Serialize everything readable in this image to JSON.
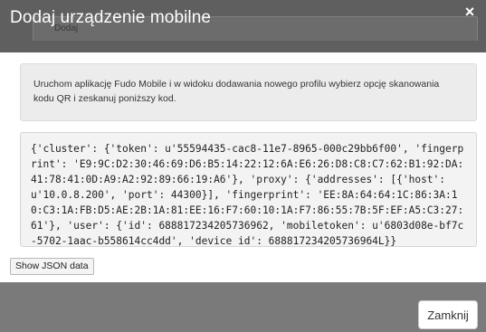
{
  "dialog": {
    "title": "Dodaj urządzenie mobilne",
    "background_tab_label": "Dodaj",
    "info_text": "Uruchom aplikację Fudo Mobile i w widoku dodawania nowego profilu wybierz opcję skanowania kodu QR i zeskanuj poniższy kod.",
    "code_text": "{'cluster': {'token': u'55594435-cac8-11e7-8965-000c29bb6f00', 'fingerprint': 'E9:9C:D2:30:46:69:D6:B5:14:22:12:6A:E6:26:D8:C8:C7:62:B1:92:DA:41:78:41:0D:A9:A2:92:89:66:19:A6'}, 'proxy': {'addresses': [{'host': u'10.0.8.200', 'port': 44300}], 'fingerprint': 'EE:8A:64:64:1C:86:3A:10:C3:1A:FB:D5:AE:2B:1A:81:EE:16:F7:60:10:1A:F7:86:55:7B:5F:EF:A5:C3:27:61'}, 'user': {'id': 688817234205736962, 'mobiletoken': u'6803d08e-bf7c-5702-1aac-b558614cc4dd', 'device_id': 688817234205736964L}}",
    "show_json_label": "Show JSON data",
    "close_label": "Zamknij",
    "close_icon": "×"
  }
}
